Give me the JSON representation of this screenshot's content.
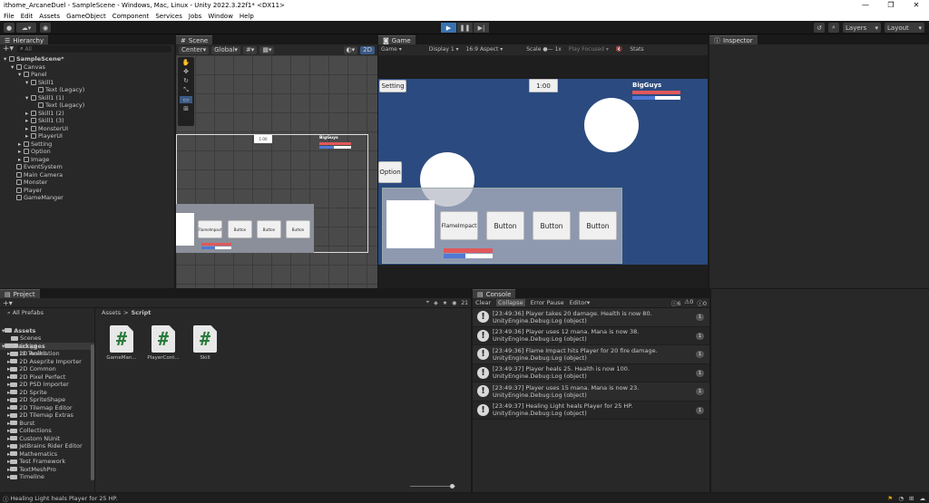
{
  "window": {
    "title": "ithome_ArcaneDuel - SampleScene - Windows, Mac, Linux - Unity 2022.3.22f1* <DX11>",
    "min": "—",
    "max": "❐",
    "close": "✕"
  },
  "menu": [
    "File",
    "Edit",
    "Assets",
    "GameObject",
    "Component",
    "Services",
    "Jobs",
    "Window",
    "Help"
  ],
  "toolbar": {
    "layers": "Layers",
    "layout": "Layout"
  },
  "hierarchy": {
    "tab": "Hierarchy",
    "search_placeholder": "All",
    "items": [
      {
        "label": "SampleScene*",
        "indent": 0
      },
      {
        "label": "Canvas",
        "indent": 1
      },
      {
        "label": "Panel",
        "indent": 2
      },
      {
        "label": "Skill1",
        "indent": 3
      },
      {
        "label": "Text (Legacy)",
        "indent": 4
      },
      {
        "label": "Skill1 (1)",
        "indent": 3
      },
      {
        "label": "Text (Legacy)",
        "indent": 4
      },
      {
        "label": "Skill1 (2)",
        "indent": 3
      },
      {
        "label": "Skill1 (3)",
        "indent": 3
      },
      {
        "label": "MonsterUI",
        "indent": 3
      },
      {
        "label": "PlayerUI",
        "indent": 3
      },
      {
        "label": "Setting",
        "indent": 2
      },
      {
        "label": "Option",
        "indent": 2
      },
      {
        "label": "Image",
        "indent": 2
      },
      {
        "label": "EventSystem",
        "indent": 1
      },
      {
        "label": "Main Camera",
        "indent": 1
      },
      {
        "label": "Monster",
        "indent": 1
      },
      {
        "label": "Player",
        "indent": 1
      },
      {
        "label": "GameManger",
        "indent": 1
      }
    ]
  },
  "scene": {
    "tab": "Scene",
    "pivot": "Center",
    "space": "Global",
    "mode": "2D",
    "time": "1:00",
    "name": "BigGuys",
    "buttons": [
      "FlameImpact",
      "Button",
      "Button",
      "Button"
    ]
  },
  "game": {
    "tab": "Game",
    "view": "Game",
    "display": "Display 1",
    "aspect": "16:9 Aspect",
    "scale_label": "Scale",
    "scale": "1x",
    "play_focused": "Play Focused",
    "stats": "Stats",
    "setting": "Setting",
    "option": "Option",
    "timer": "1:00",
    "enemy_name": "BigGuys",
    "skills": [
      "FlameImpact",
      "Button",
      "Button",
      "Button"
    ],
    "colors": {
      "bg": "#2b4a7f",
      "hp": "#e0585b",
      "mp": "#4f78d6"
    }
  },
  "inspector": {
    "tab": "Inspector"
  },
  "project": {
    "tab": "Project",
    "breadcrumb_root": "Assets",
    "breadcrumb_leaf": "Script",
    "count": "21",
    "favorites": "All Prefabs",
    "assets_root": "Assets",
    "assets_children": [
      "Scenes",
      "Script",
      "UI Toolkit"
    ],
    "packages_root": "Packages",
    "packages": [
      "2D Animation",
      "2D Aseprite Importer",
      "2D Common",
      "2D Pixel Perfect",
      "2D PSD Importer",
      "2D Sprite",
      "2D SpriteShape",
      "2D Tilemap Editor",
      "2D Tilemap Extras",
      "Burst",
      "Collections",
      "Custom NUnit",
      "JetBrains Rider Editor",
      "Mathematics",
      "Test Framework",
      "TextMeshPro",
      "Timeline"
    ],
    "files": [
      "GameMan...",
      "PlayerCont...",
      "Skill"
    ]
  },
  "console": {
    "tab": "Console",
    "clear": "Clear",
    "collapse": "Collapse",
    "error_pause": "Error Pause",
    "editor": "Editor",
    "counts": {
      "log": "6",
      "warn": "0",
      "err": "0"
    },
    "entries": [
      {
        "line1": "[23:49:36] Player takes 20 damage. Health is now 80.",
        "line2": "UnityEngine.Debug:Log (object)",
        "count": "1"
      },
      {
        "line1": "[23:49:36] Player uses 12 mana. Mana is now 38.",
        "line2": "UnityEngine.Debug:Log (object)",
        "count": "1"
      },
      {
        "line1": "[23:49:36] Flame Impact hits Player for 20 fire damage.",
        "line2": "UnityEngine.Debug:Log (object)",
        "count": "1"
      },
      {
        "line1": "[23:49:37] Player heals 25. Health is now 100.",
        "line2": "UnityEngine.Debug:Log (object)",
        "count": "1"
      },
      {
        "line1": "[23:49:37] Player uses 15 mana. Mana is now 23.",
        "line2": "UnityEngine.Debug:Log (object)",
        "count": "1"
      },
      {
        "line1": "[23:49:37] Healing Light heals Player for 25 HP.",
        "line2": "UnityEngine.Debug:Log (object)",
        "count": "1"
      }
    ]
  },
  "statusbar": {
    "message": "Healing Light heals Player for 25 HP."
  }
}
